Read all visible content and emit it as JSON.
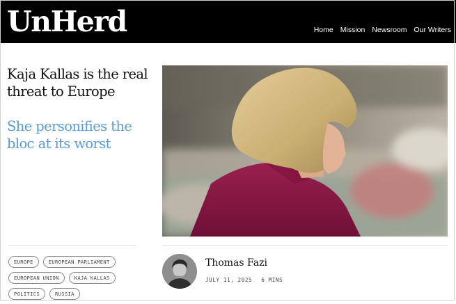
{
  "header": {
    "logo": "UnHerd",
    "nav": [
      "Home",
      "Mission",
      "Newsroom",
      "Our Writers"
    ]
  },
  "article": {
    "title": "Kaja Kallas is the real threat to Europe",
    "subtitle": "She personifies the bloc at its worst"
  },
  "tags": [
    [
      "EUROPE",
      "EUROPEAN PARLIAMENT"
    ],
    [
      "EUROPEAN UNION",
      "KAJA KALLAS"
    ],
    [
      "POLITICS",
      "RUSSIA"
    ]
  ],
  "author": {
    "name": "Thomas Fazi",
    "date": "JULY 11, 2025",
    "read_time": "6 MINS"
  },
  "colors": {
    "header_bg": "#000000",
    "subtitle": "#5b9bd5"
  }
}
